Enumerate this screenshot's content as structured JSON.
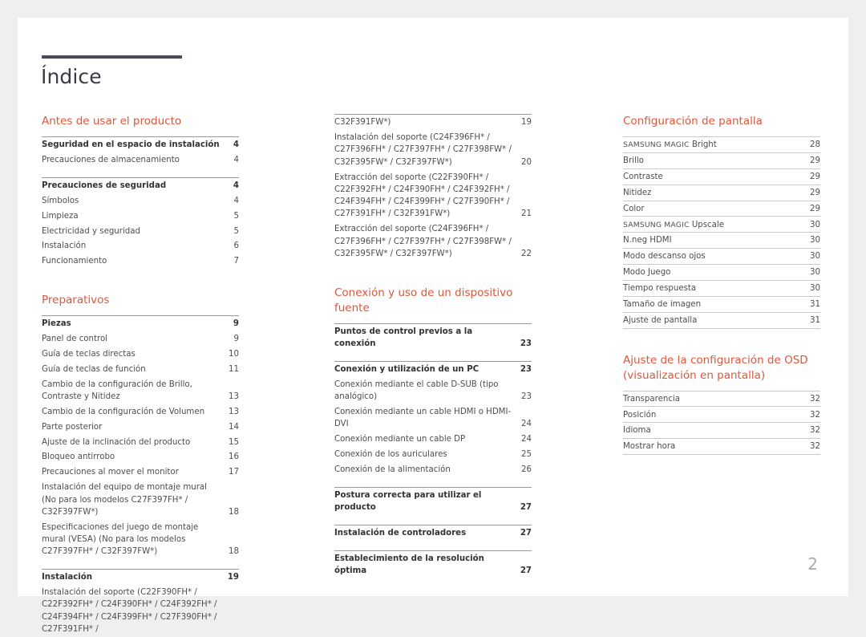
{
  "document": {
    "title": "Índice",
    "folio": "2",
    "accent_color": "#e1563a",
    "rule_color": "#4a4a5c"
  },
  "columns": [
    {
      "id": "column-1",
      "sections": [
        {
          "heading": "Antes de usar el producto",
          "groups": [
            {
              "entries": [
                {
                  "label": "Seguridad en el espacio de instalación",
                  "page": "4",
                  "bold": true
                },
                {
                  "label": "Precauciones de almacenamiento",
                  "page": "4",
                  "bold": false
                }
              ]
            },
            {
              "entries": [
                {
                  "label": "Precauciones de seguridad",
                  "page": "4",
                  "bold": true
                },
                {
                  "label": "Símbolos",
                  "page": "4",
                  "bold": false
                },
                {
                  "label": "Limpieza",
                  "page": "5",
                  "bold": false
                },
                {
                  "label": "Electricidad y seguridad",
                  "page": "5",
                  "bold": false
                },
                {
                  "label": "Instalación",
                  "page": "6",
                  "bold": false
                },
                {
                  "label": "Funcionamiento",
                  "page": "7",
                  "bold": false
                }
              ]
            }
          ]
        },
        {
          "heading": "Preparativos",
          "groups": [
            {
              "entries": [
                {
                  "label": "Piezas",
                  "page": "9",
                  "bold": true
                },
                {
                  "label": "Panel de control",
                  "page": "9",
                  "bold": false
                },
                {
                  "label": "Guía de teclas directas",
                  "page": "10",
                  "bold": false
                },
                {
                  "label": "Guía de teclas de función",
                  "page": "11",
                  "bold": false
                },
                {
                  "label": "Cambio de la configuración de Brillo, Contraste y Nitidez",
                  "page": "13",
                  "bold": false
                },
                {
                  "label": "Cambio de la configuración de Volumen",
                  "page": "13",
                  "bold": false
                },
                {
                  "label": "Parte posterior",
                  "page": "14",
                  "bold": false
                },
                {
                  "label": "Ajuste de la inclinación del producto",
                  "page": "15",
                  "bold": false
                },
                {
                  "label": "Bloqueo antirrobo",
                  "page": "16",
                  "bold": false
                },
                {
                  "label": "Precauciones al mover el monitor",
                  "page": "17",
                  "bold": false
                },
                {
                  "label": "Instalación del equipo de montaje mural (No para los modelos C27F397FH* / C32F397FW*)",
                  "page": "18",
                  "bold": false
                },
                {
                  "label": "Especificaciones del juego de montaje mural (VESA) (No para los modelos C27F397FH* / C32F397FW*)",
                  "page": "18",
                  "bold": false
                }
              ]
            },
            {
              "entries": [
                {
                  "label": "Instalación",
                  "page": "19",
                  "bold": true
                },
                {
                  "label": "Instalación del soporte (C22F390FH* / C22F392FH* / C24F390FH* / C24F392FH* / C24F394FH* / C24F399FH* / C27F390FH* / C27F391FH* /",
                  "page": "",
                  "bold": false
                }
              ]
            }
          ]
        }
      ]
    },
    {
      "id": "column-2",
      "sections": [
        {
          "heading": "",
          "groups": [
            {
              "entries": [
                {
                  "label": "C32F391FW*)",
                  "page": "19",
                  "bold": false
                },
                {
                  "label": "Instalación del soporte (C24F396FH* / C27F396FH* / C27F397FH* / C27F398FW* / C32F395FW* / C32F397FW*)",
                  "page": "20",
                  "bold": false
                },
                {
                  "label": "Extracción del soporte (C22F390FH* / C22F392FH* / C24F390FH* / C24F392FH* / C24F394FH* / C24F399FH* / C27F390FH* / C27F391FH* / C32F391FW*)",
                  "page": "21",
                  "bold": false
                },
                {
                  "label": "Extracción del soporte (C24F396FH* / C27F396FH* / C27F397FH* / C27F398FW* / C32F395FW* / C32F397FW*)",
                  "page": "22",
                  "bold": false
                }
              ]
            }
          ]
        },
        {
          "heading": "Conexión y uso de un dispositivo fuente",
          "groups": [
            {
              "entries": [
                {
                  "label": "Puntos de control previos a la conexión",
                  "page": "23",
                  "bold": true
                }
              ]
            },
            {
              "entries": [
                {
                  "label": "Conexión y utilización de un PC",
                  "page": "23",
                  "bold": true
                },
                {
                  "label": "Conexión mediante el cable D-SUB (tipo analógico)",
                  "page": "23",
                  "bold": false
                },
                {
                  "label": "Conexión mediante un cable HDMI o HDMI-DVI",
                  "page": "24",
                  "bold": false
                },
                {
                  "label": "Conexión mediante un cable DP",
                  "page": "24",
                  "bold": false
                },
                {
                  "label": "Conexión de los auriculares",
                  "page": "25",
                  "bold": false
                },
                {
                  "label": "Conexión de la alimentación",
                  "page": "26",
                  "bold": false
                }
              ]
            },
            {
              "entries": [
                {
                  "label": "Postura correcta para utilizar el producto",
                  "page": "27",
                  "bold": true
                }
              ]
            },
            {
              "entries": [
                {
                  "label": "Instalación de controladores",
                  "page": "27",
                  "bold": true
                }
              ]
            },
            {
              "entries": [
                {
                  "label": "Establecimiento de la resolución óptima",
                  "page": "27",
                  "bold": true
                }
              ]
            }
          ]
        }
      ]
    },
    {
      "id": "column-3",
      "sections": [
        {
          "heading": "Configuración de pantalla",
          "ruled_rows": true,
          "groups": [
            {
              "entries": [
                {
                  "label": "SAMSUNG MAGIC Bright",
                  "page": "28",
                  "bold": false,
                  "smallcaps_prefix": "SAMSUNG MAGIC",
                  "smallcaps_rest": " Bright"
                },
                {
                  "label": "Brillo",
                  "page": "29",
                  "bold": false
                },
                {
                  "label": "Contraste",
                  "page": "29",
                  "bold": false
                },
                {
                  "label": "Nitidez",
                  "page": "29",
                  "bold": false
                },
                {
                  "label": "Color",
                  "page": "29",
                  "bold": false
                },
                {
                  "label": "SAMSUNG MAGIC Upscale",
                  "page": "30",
                  "bold": false,
                  "smallcaps_prefix": "SAMSUNG MAGIC",
                  "smallcaps_rest": " Upscale"
                },
                {
                  "label": "N.neg HDMI",
                  "page": "30",
                  "bold": false
                },
                {
                  "label": "Modo descanso ojos",
                  "page": "30",
                  "bold": false
                },
                {
                  "label": "Modo Juego",
                  "page": "30",
                  "bold": false
                },
                {
                  "label": "Tiempo respuesta",
                  "page": "30",
                  "bold": false
                },
                {
                  "label": "Tamaño de imagen",
                  "page": "31",
                  "bold": false
                },
                {
                  "label": "Ajuste de pantalla",
                  "page": "31",
                  "bold": false
                }
              ]
            }
          ]
        },
        {
          "heading": "Ajuste de la configuración de OSD (visualización en pantalla)",
          "ruled_rows": true,
          "groups": [
            {
              "entries": [
                {
                  "label": "Transparencia",
                  "page": "32",
                  "bold": false
                },
                {
                  "label": "Posición",
                  "page": "32",
                  "bold": false
                },
                {
                  "label": "Idioma",
                  "page": "32",
                  "bold": false
                },
                {
                  "label": "Mostrar hora",
                  "page": "32",
                  "bold": false
                }
              ]
            }
          ]
        }
      ]
    }
  ]
}
